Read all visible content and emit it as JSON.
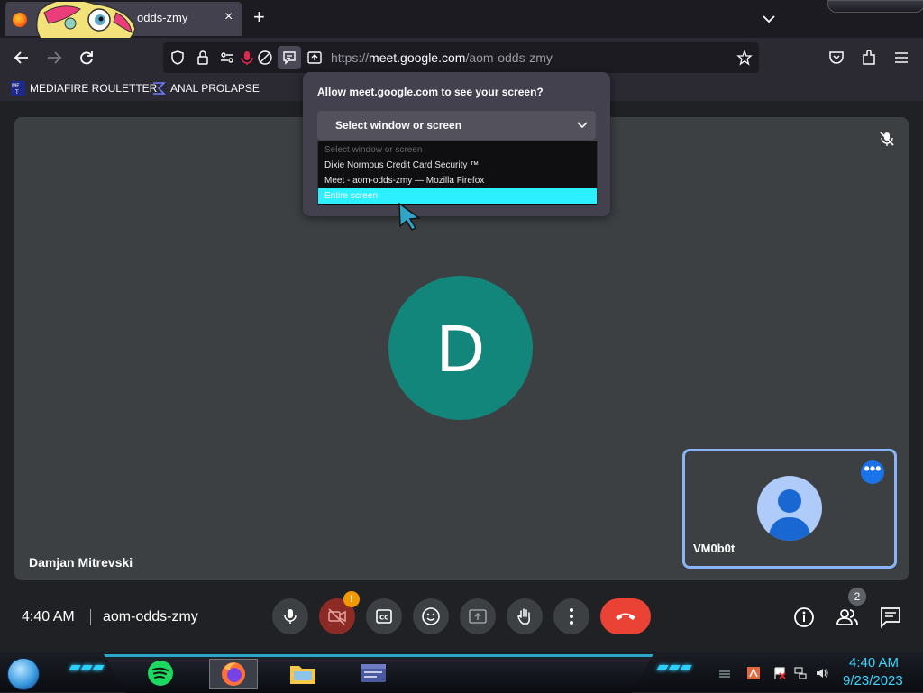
{
  "browser": {
    "tab": {
      "title": "odds-zmy",
      "close_label": "×"
    },
    "new_tab_label": "+",
    "url": {
      "host": "meet.google.com",
      "prefix": "https://",
      "path": "/aom-odds-zmy"
    },
    "bookmarks": [
      {
        "label": "MEDIAFIRE ROULETTER"
      },
      {
        "label": "ANAL PROLAPSE"
      }
    ]
  },
  "permission_popup": {
    "title": "Allow meet.google.com to see your screen?",
    "select_label": "Select window or screen",
    "options": [
      {
        "label": "Select window or screen",
        "placeholder": true
      },
      {
        "label": "Dixie Normous Credit Card Security ™"
      },
      {
        "label": "Meet - aom-odds-zmy — Mozilla Firefox"
      },
      {
        "label": "Entire screen",
        "selected": true
      }
    ]
  },
  "meet": {
    "main_participant": {
      "initial": "D",
      "name": "Damjan Mitrevski",
      "avatar_color": "#12867a"
    },
    "self_participant": {
      "name": "VM0b0t",
      "more_label": "•••"
    },
    "time": "4:40 AM",
    "meeting_code": "aom-odds-zmy",
    "camera_warning": "!",
    "people_count": "2",
    "colors": {
      "end_call": "#ea4335",
      "accent": "#8ab4f8"
    }
  },
  "taskbar": {
    "clock_time": "4:40 AM",
    "clock_date": "9/23/2023"
  }
}
